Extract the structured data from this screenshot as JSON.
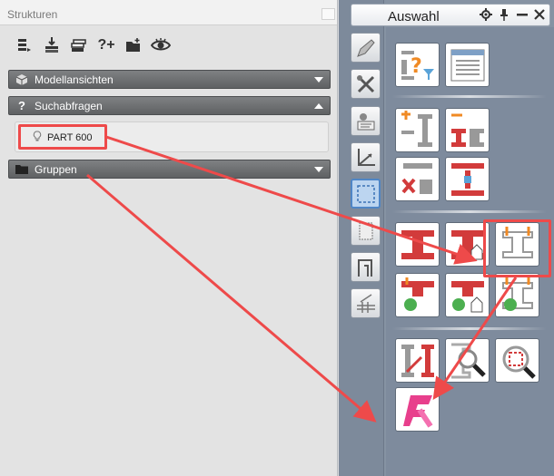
{
  "left_panel": {
    "title": "Strukturen",
    "toolbar": [
      {
        "icon": "layers-icon"
      },
      {
        "icon": "insert-icon"
      },
      {
        "icon": "stack-icon"
      },
      {
        "icon": "query-add-icon",
        "label": "?+"
      },
      {
        "icon": "folder-add-icon"
      },
      {
        "icon": "eye-icon"
      }
    ],
    "sections": [
      {
        "label": "Modellansichten",
        "icon": "cube-icon",
        "expanded": false
      },
      {
        "label": "Suchabfragen",
        "icon": "question-icon",
        "expanded": true
      },
      {
        "label": "Gruppen",
        "icon": "folder-icon",
        "expanded": false
      }
    ],
    "query_item": {
      "label": "PART 600",
      "icon": "bulb-icon"
    }
  },
  "right_panel": {
    "title": "Auswahl",
    "controls": [
      "gear-icon",
      "pin-icon",
      "minimize-icon",
      "close-icon"
    ],
    "side_tools": [
      "pencil-icon",
      "tools-icon",
      "user-card-icon",
      "axes-icon",
      "select-rect-icon",
      "sheet-icon",
      "profile-icon",
      "grid-icon"
    ],
    "tools": [
      "filter-query-icon",
      "list-window-icon",
      "beam-add-icon",
      "beam-remove-icon",
      "beam-delete-icon",
      "beam-grid-icon",
      "beam-red-1-icon",
      "beam-red-2-icon",
      "beam-outline-icon",
      "beam-refresh-1-icon",
      "beam-refresh-2-icon",
      "beam-refresh-3-icon",
      "beam-arrow-icon",
      "beam-zoom-icon",
      "zoom-frame-icon",
      "app-logo-icon"
    ]
  },
  "colors": {
    "annotation": "#ee4a4a",
    "accent_selection": "#4f86c6",
    "beam_red": "#d23b3b"
  }
}
